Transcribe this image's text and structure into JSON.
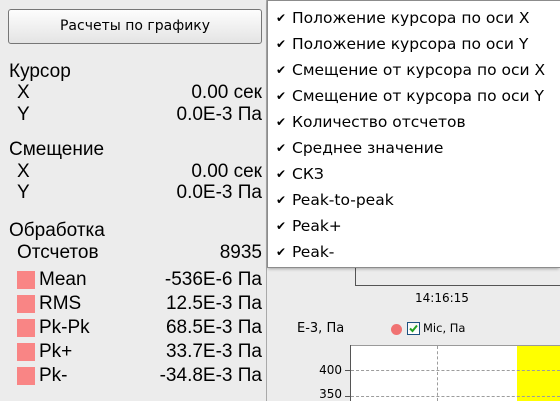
{
  "calc_panel": {
    "button_label": "Расчеты по графику",
    "cursor": {
      "title": "Курсор",
      "x_label": "X",
      "x_value": "0.00 сек",
      "y_label": "Y",
      "y_value": "0.0E-3 Па"
    },
    "offset": {
      "title": "Смещение",
      "x_label": "X",
      "x_value": "0.00 сек",
      "y_label": "Y",
      "y_value": "0.0E-3 Па"
    },
    "processing": {
      "title": "Обработка",
      "count_label": "Отсчетов",
      "count_value": "8935",
      "swatch_color": "#f98585",
      "rows": [
        {
          "label": "Mean",
          "value": "-536E-6 Па"
        },
        {
          "label": "RMS",
          "value": "12.5E-3 Па"
        },
        {
          "label": "Pk-Pk",
          "value": "68.5E-3 Па"
        },
        {
          "label": "Pk+",
          "value": "33.7E-3 Па"
        },
        {
          "label": "Pk-",
          "value": "-34.8E-3 Па"
        }
      ]
    }
  },
  "context_menu": {
    "check_icon": "check-icon",
    "items": [
      {
        "label": "Положение курсора по оси X",
        "checked": true
      },
      {
        "label": "Положение курсора по оси Y",
        "checked": true
      },
      {
        "label": "Смещение от курсора по оси X",
        "checked": true
      },
      {
        "label": "Смещение от курсора по оси Y",
        "checked": true
      },
      {
        "label": "Количество отсчетов",
        "checked": true
      },
      {
        "label": "Среднее значение",
        "checked": true
      },
      {
        "label": "СКЗ",
        "checked": true
      },
      {
        "label": "Peak-to-peak",
        "checked": true
      },
      {
        "label": "Peak+",
        "checked": true
      },
      {
        "label": "Peak-",
        "checked": true
      }
    ]
  },
  "graph": {
    "time_label": "14:16:15",
    "y_unit": "E-3, Па",
    "legend": {
      "series_name": "Mic, Па",
      "checked": true,
      "marker_color": "#f07272"
    },
    "y_ticks": [
      "400",
      "350"
    ],
    "highlight_color": "#ffff00"
  }
}
